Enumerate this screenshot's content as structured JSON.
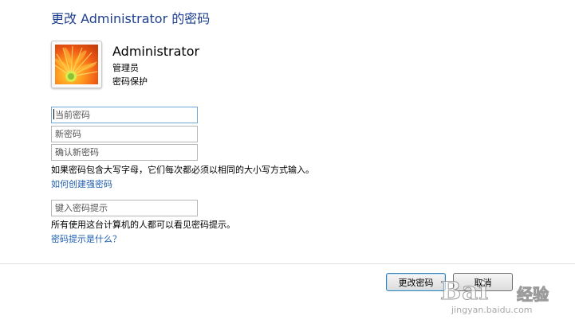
{
  "page": {
    "title": "更改 Administrator 的密码"
  },
  "user": {
    "name": "Administrator",
    "role": "管理员",
    "status": "密码保护",
    "avatar_icon": "flower-avatar-icon"
  },
  "form": {
    "current_password": {
      "placeholder": "当前密码",
      "value": ""
    },
    "new_password": {
      "placeholder": "新密码",
      "value": ""
    },
    "confirm_password": {
      "placeholder": "确认新密码",
      "value": ""
    },
    "case_notice": "如果密码包含大写字母，它们每次都必须以相同的大小写方式输入。",
    "strong_password_link": "如何创建强密码",
    "hint": {
      "placeholder": "键入密码提示",
      "value": ""
    },
    "hint_notice": "所有使用这台计算机的人都可以看见密码提示。",
    "hint_help_link": "密码提示是什么？"
  },
  "buttons": {
    "change_password": "更改密码",
    "cancel": "取消"
  },
  "watermark": {
    "mark": "Bai",
    "sub": "经验",
    "url": "jingyan.baidu.com"
  },
  "colors": {
    "title": "#1e3f8f",
    "link": "#1f5eb0",
    "focus_border": "#6fa7d8"
  }
}
